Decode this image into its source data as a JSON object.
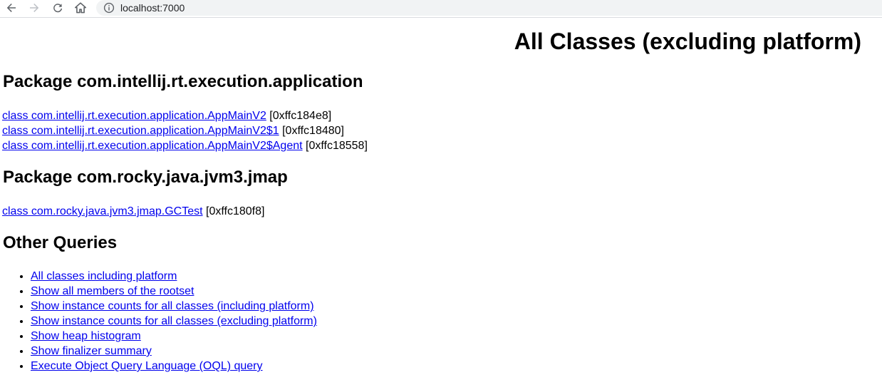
{
  "browser": {
    "url": "localhost:7000",
    "icons": {
      "back": "back-arrow-icon",
      "forward": "forward-arrow-icon",
      "reload": "reload-icon",
      "home": "home-icon",
      "info": "info-icon"
    }
  },
  "page": {
    "title": "All Classes (excluding platform)",
    "packages": [
      {
        "heading": "Package com.intellij.rt.execution.application",
        "classes": [
          {
            "label": "class com.intellij.rt.execution.application.AppMainV2",
            "addr": " [0xffc184e8]"
          },
          {
            "label": "class com.intellij.rt.execution.application.AppMainV2$1",
            "addr": " [0xffc18480]"
          },
          {
            "label": "class com.intellij.rt.execution.application.AppMainV2$Agent",
            "addr": " [0xffc18558]"
          }
        ]
      },
      {
        "heading": "Package com.rocky.java.jvm3.jmap",
        "classes": [
          {
            "label": "class com.rocky.java.jvm3.jmap.GCTest",
            "addr": " [0xffc180f8]"
          }
        ]
      }
    ],
    "other_queries": {
      "heading": "Other Queries",
      "links": [
        "All classes including platform",
        "Show all members of the rootset",
        "Show instance counts for all classes (including platform)",
        "Show instance counts for all classes (excluding platform)",
        "Show heap histogram",
        "Show finalizer summary",
        "Execute Object Query Language (OQL) query"
      ]
    }
  },
  "colors": {
    "link": "#0000ee",
    "toolbar_icon": "#5f6368",
    "toolbar_icon_disabled": "#bdc1c6",
    "omnibox_bg": "#f1f3f4"
  }
}
